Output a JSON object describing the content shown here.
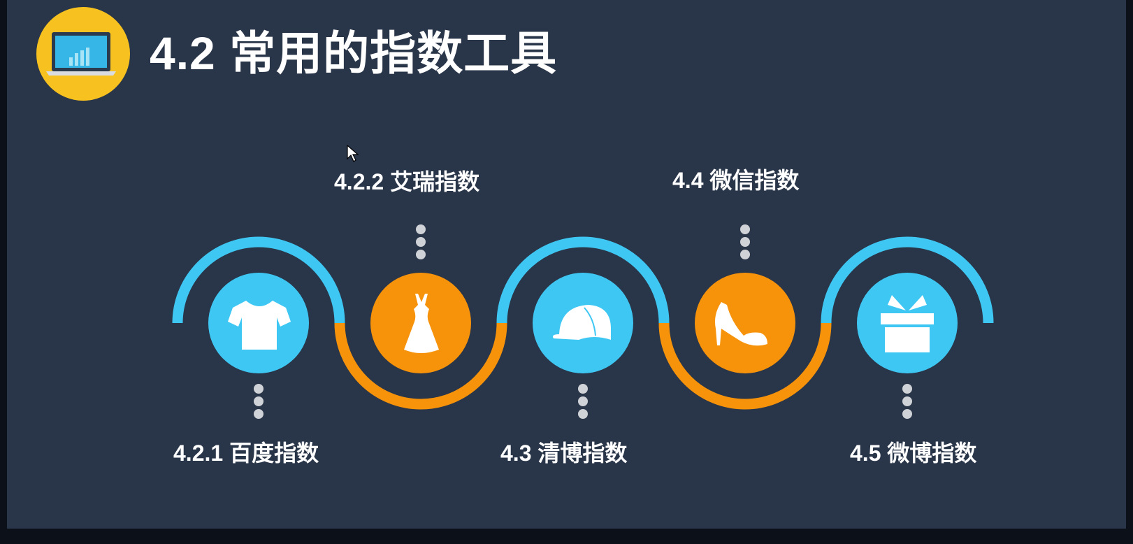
{
  "slide": {
    "title": "4.2 常用的指数工具"
  },
  "colors": {
    "background": "#293548",
    "logo_circle": "#f7c21f",
    "blue": "#3fc7f3",
    "orange": "#f7930b",
    "dots": "#cfd2d6"
  },
  "steps": [
    {
      "label": "4.2.1 百度指数",
      "icon": "t-shirt-icon",
      "color": "blue",
      "position": "bottom"
    },
    {
      "label": "4.2.2 艾瑞指数",
      "icon": "dress-icon",
      "color": "orange",
      "position": "top"
    },
    {
      "label": "4.3 清博指数",
      "icon": "cap-icon",
      "color": "blue",
      "position": "bottom"
    },
    {
      "label": "4.4 微信指数",
      "icon": "high-heel-shoe-icon",
      "color": "orange",
      "position": "top"
    },
    {
      "label": "4.5 微博指数",
      "icon": "gift-box-icon",
      "color": "blue",
      "position": "bottom"
    }
  ]
}
